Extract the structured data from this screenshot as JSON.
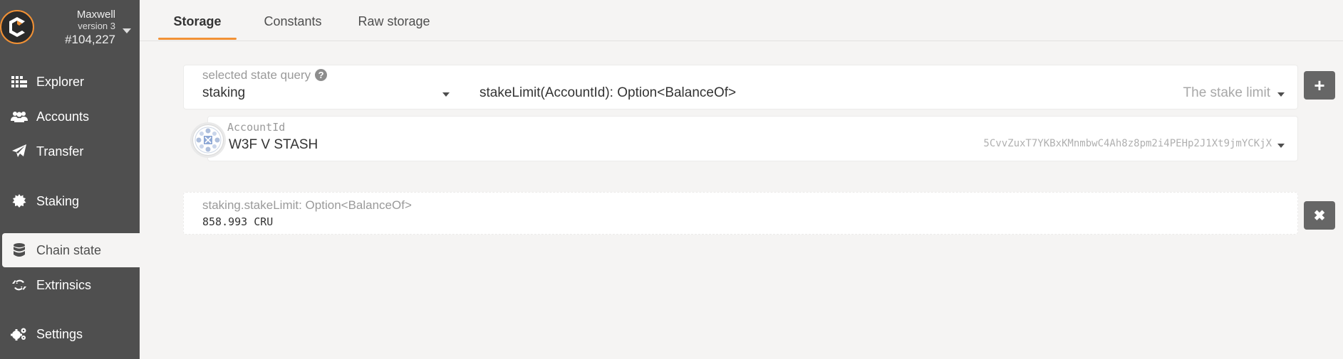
{
  "brand": {
    "chain_name": "Maxwell",
    "version": "version 3",
    "block": "#104,227"
  },
  "sidebar": {
    "items": [
      {
        "label": "Explorer",
        "icon": "explorer-icon"
      },
      {
        "label": "Accounts",
        "icon": "users-icon"
      },
      {
        "label": "Transfer",
        "icon": "paper-plane-icon"
      },
      {
        "label": "Staking",
        "icon": "certificate-icon"
      },
      {
        "label": "Chain state",
        "icon": "database-icon",
        "active": true
      },
      {
        "label": "Extrinsics",
        "icon": "sync-icon"
      },
      {
        "label": "Settings",
        "icon": "cogs-icon"
      }
    ]
  },
  "tabs": [
    {
      "label": "Storage",
      "active": true
    },
    {
      "label": "Constants"
    },
    {
      "label": "Raw storage"
    }
  ],
  "query": {
    "label": "selected state query",
    "section": "staking",
    "method": "stakeLimit(AccountId): Option<BalanceOf>",
    "description": "The stake limit"
  },
  "account": {
    "label": "AccountId",
    "name": "W3F V STASH",
    "address": "5CvvZuxT7YKBxKMnmbwC4Ah8z8pm2i4PEHp2J1Xt9jmYCKjX"
  },
  "result": {
    "label": "staking.stakeLimit: Option<BalanceOf>",
    "value": "858.993 CRU"
  },
  "colors": {
    "accent": "#f19135",
    "sidebar_bg": "#4f4f4f",
    "button_bg": "#666666"
  }
}
